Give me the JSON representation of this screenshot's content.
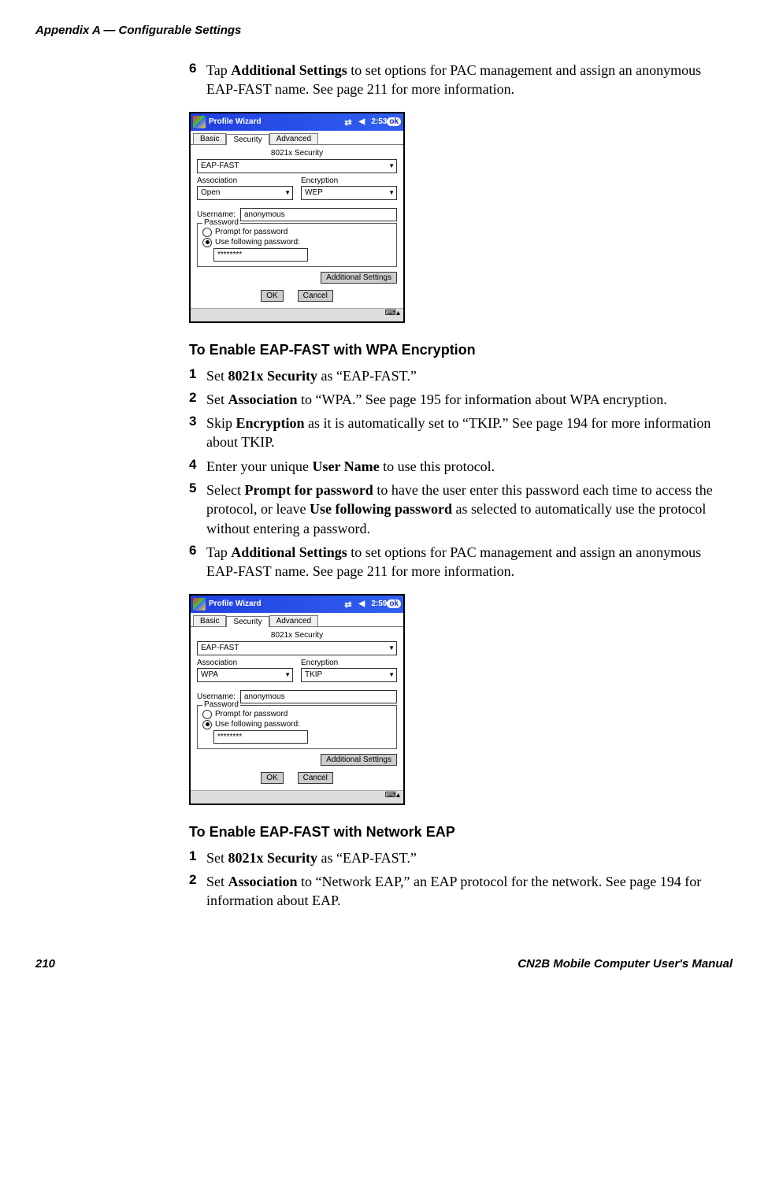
{
  "header": "Appendix A — Configurable Settings",
  "footer": {
    "page": "210",
    "manual": "CN2B Mobile Computer User's Manual"
  },
  "step6a": {
    "num": "6",
    "parts": [
      "Tap ",
      "Additional Settings",
      " to set options for PAC management and assign an anonymous EAP-FAST name. See page 211 for more information."
    ]
  },
  "shot1": {
    "title": "Profile Wizard",
    "time": "2:53",
    "ok": "ok",
    "tabs": [
      "Basic",
      "Security",
      "Advanced"
    ],
    "activeTab": 1,
    "secLabel": "8021x Security",
    "secVal": "EAP-FAST",
    "assocLabel": "Association",
    "assocVal": "Open",
    "encLabel": "Encryption",
    "encVal": "WEP",
    "userLabel": "Username:",
    "userVal": "anonymous",
    "pwLegend": "Password",
    "r1": "Prompt for password",
    "r2": "Use following password:",
    "pw": "********",
    "addBtn": "Additional Settings",
    "okBtn": "OK",
    "cancelBtn": "Cancel"
  },
  "h_wpa": "To Enable EAP-FAST with WPA Encryption",
  "wpa_steps": [
    {
      "num": "1",
      "parts": [
        "Set ",
        "8021x Security",
        " as “EAP-FAST.”"
      ]
    },
    {
      "num": "2",
      "parts": [
        "Set ",
        "Association",
        " to “WPA.” See page 195 for information about WPA encryption."
      ]
    },
    {
      "num": "3",
      "parts": [
        "Skip ",
        "Encryption",
        " as it is automatically set to “TKIP.” See page 194 for more information about TKIP."
      ]
    },
    {
      "num": "4",
      "parts": [
        "Enter your unique ",
        "User Name",
        " to use this protocol."
      ]
    },
    {
      "num": "5",
      "parts": [
        "Select ",
        "Prompt for password",
        " to have the user enter this password each time to access the protocol, or leave ",
        "Use following password",
        " as selected to automatically use the protocol without entering a password."
      ]
    },
    {
      "num": "6",
      "parts": [
        "Tap ",
        "Additional Settings",
        " to set options for PAC management and assign an anonymous EAP-FAST name. See page 211 for more information."
      ]
    }
  ],
  "shot2": {
    "title": "Profile Wizard",
    "time": "2:59",
    "ok": "ok",
    "tabs": [
      "Basic",
      "Security",
      "Advanced"
    ],
    "activeTab": 1,
    "secLabel": "8021x Security",
    "secVal": "EAP-FAST",
    "assocLabel": "Association",
    "assocVal": "WPA",
    "encLabel": "Encryption",
    "encVal": "TKIP",
    "userLabel": "Username:",
    "userVal": "anonymous",
    "pwLegend": "Password",
    "r1": "Prompt for password",
    "r2": "Use following password:",
    "pw": "********",
    "addBtn": "Additional Settings",
    "okBtn": "OK",
    "cancelBtn": "Cancel"
  },
  "h_eap": "To Enable EAP-FAST with Network EAP",
  "eap_steps": [
    {
      "num": "1",
      "parts": [
        "Set ",
        "8021x Security",
        " as “EAP-FAST.”"
      ]
    },
    {
      "num": "2",
      "parts": [
        "Set ",
        "Association",
        " to “Network EAP,” an EAP protocol for the network. See page 194 for information about EAP."
      ]
    }
  ]
}
